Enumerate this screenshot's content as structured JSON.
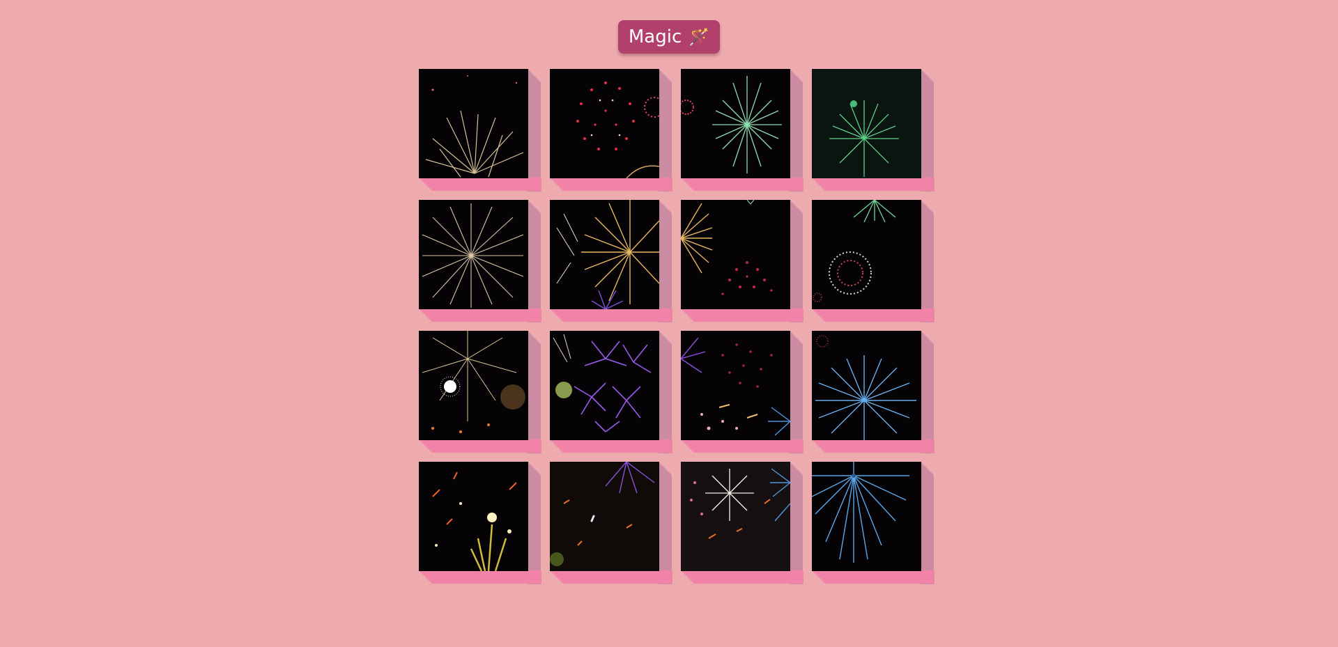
{
  "toolbar": {
    "magic_label": "Magic",
    "magic_icon": "magic-wand-icon",
    "magic_glyph": "🪄"
  },
  "colors": {
    "background": "#eeabad",
    "button": "#b1406a",
    "tile_face": "#050305",
    "tile_side": "#cb8ba2",
    "tile_bottom": "#f083a7"
  },
  "tiles": [
    {
      "name": "tile-1-1",
      "subject": "gold-sparkle-firework"
    },
    {
      "name": "tile-1-2",
      "subject": "red-firework"
    },
    {
      "name": "tile-1-3",
      "subject": "green-firework"
    },
    {
      "name": "tile-1-4",
      "subject": "green-firework"
    },
    {
      "name": "tile-2-1",
      "subject": "gold-sparkle-firework"
    },
    {
      "name": "tile-2-2",
      "subject": "gold-firework"
    },
    {
      "name": "tile-2-3",
      "subject": "gold-and-red-firework"
    },
    {
      "name": "tile-2-4",
      "subject": "green-and-white-firework"
    },
    {
      "name": "tile-3-1",
      "subject": "gold-sparkle-firework"
    },
    {
      "name": "tile-3-2",
      "subject": "purple-firework"
    },
    {
      "name": "tile-3-3",
      "subject": "red-firework"
    },
    {
      "name": "tile-3-4",
      "subject": "blue-firework"
    },
    {
      "name": "tile-4-1",
      "subject": "yellow-sparks"
    },
    {
      "name": "tile-4-2",
      "subject": "purple-firework-embers"
    },
    {
      "name": "tile-4-3",
      "subject": "white-and-pink-firework"
    },
    {
      "name": "tile-4-4",
      "subject": "blue-firework"
    }
  ]
}
